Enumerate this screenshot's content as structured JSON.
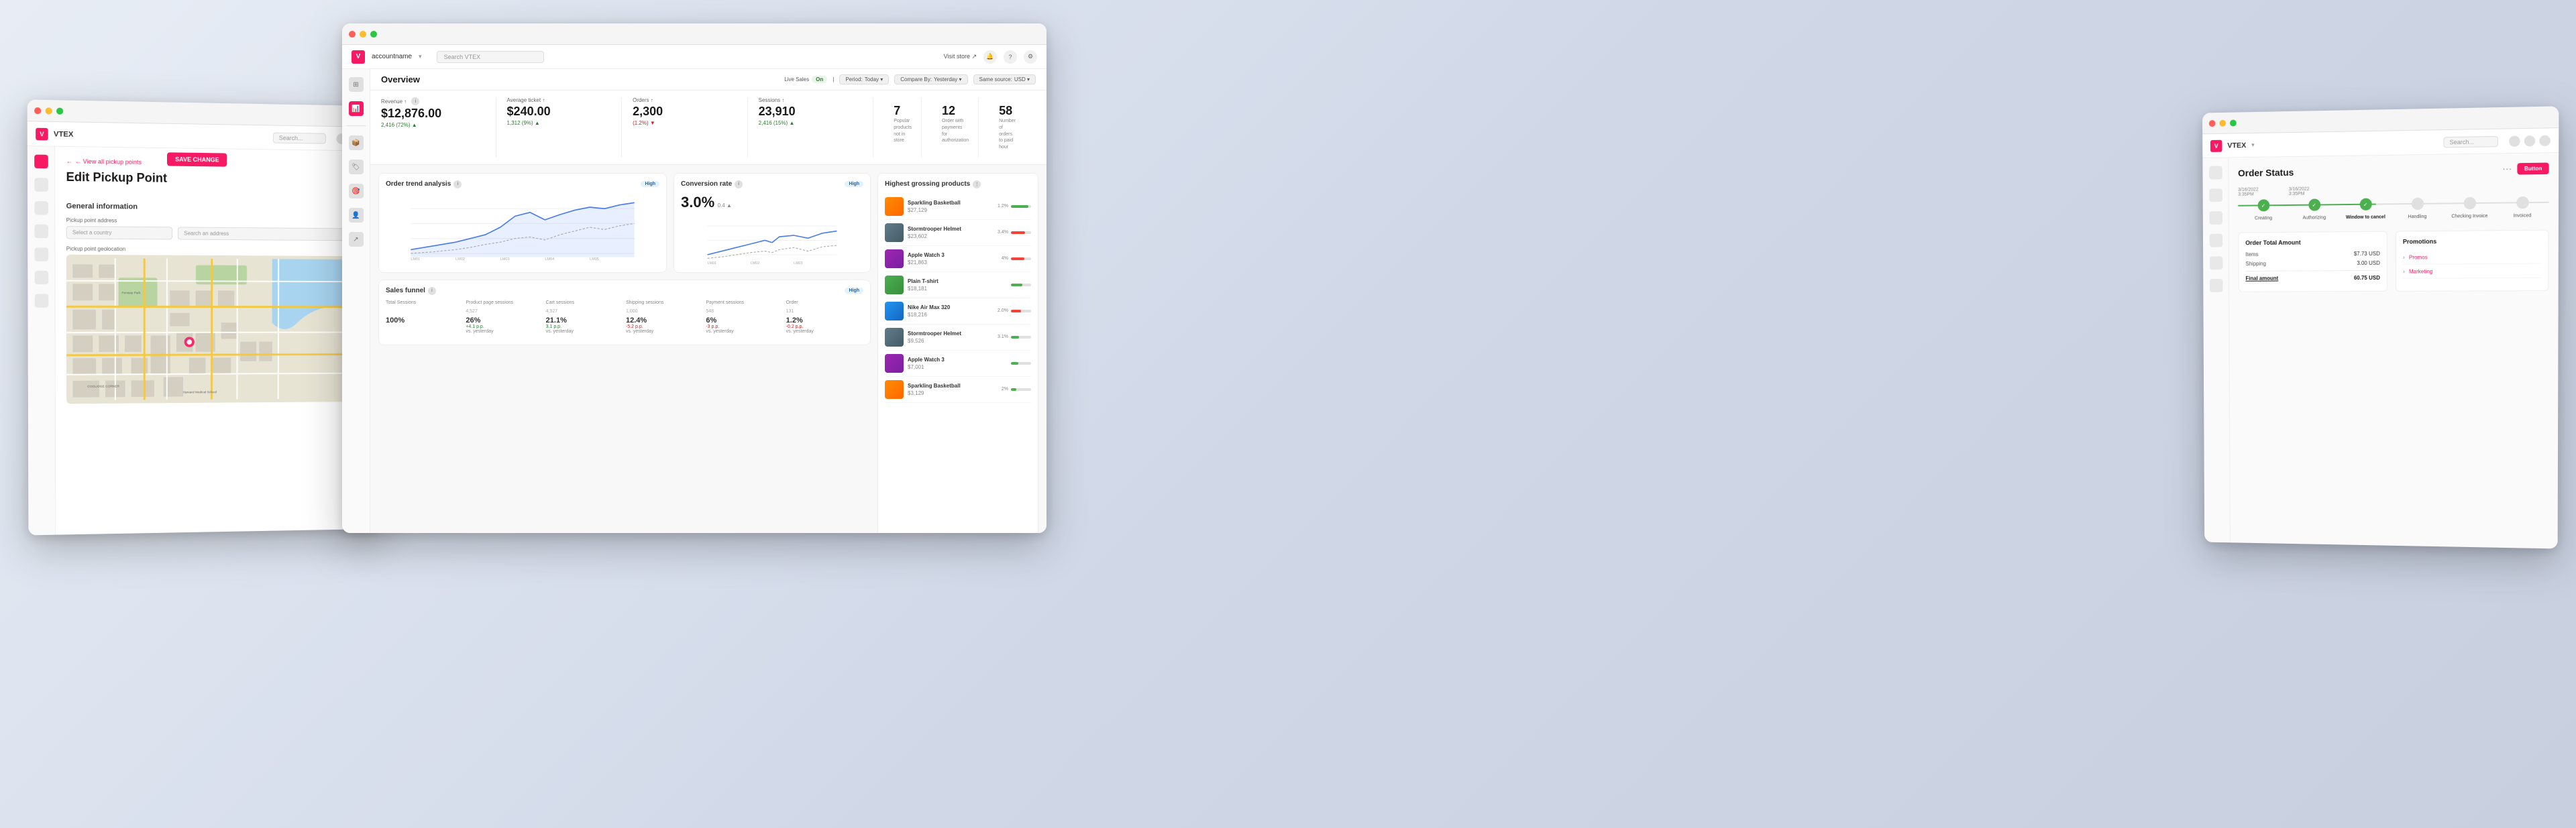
{
  "app": {
    "brand": "VTEX",
    "logo_letter": "V"
  },
  "window_left": {
    "title": "Edit Pickup Point",
    "back_link": "← View all pickup points",
    "save_btn": "SAVE CHANGE",
    "section_general": "General information",
    "section_address": "Pickup point address",
    "label_country": "Select a country",
    "label_address": "Search an address",
    "section_geolocation": "Pickup point geolocation",
    "search_placeholder": "Search..."
  },
  "window_center": {
    "account": "accountname",
    "chevron": "v",
    "search_placeholder": "Search VTEX",
    "visit_store": "Visit store ↗",
    "page_title": "Overview",
    "filter_live_sales": "Live Sales",
    "filter_on": "On",
    "filter_period": "Period:",
    "filter_today": "Today ▾",
    "filter_compare": "Compare By:",
    "filter_yesterday": "Yesterday ▾",
    "filter_source": "Same source:",
    "filter_usd": "USD ▾",
    "metrics": [
      {
        "label": "Revenue ↑",
        "value": "$12,876.00",
        "change": "2,416 (72%)  ▲",
        "type": "pos"
      },
      {
        "label": "Average ticket ↑",
        "value": "$240.00",
        "change": "1,312 (9%)  ▲",
        "type": "pos"
      },
      {
        "label": "Orders ↑",
        "value": "2,300",
        "change": "(1.2%)  ▼",
        "type": "neg"
      },
      {
        "label": "Sessions ↑",
        "value": "23,910",
        "change": "2,416 (15%)  ▲",
        "type": "pos"
      }
    ],
    "stat_boxes": [
      {
        "num": "7",
        "desc": "Popular products not in store"
      },
      {
        "num": "12",
        "desc": "Order with payments for authorization"
      },
      {
        "num": "58",
        "desc": "Number of orders to paid hour"
      }
    ],
    "charts": {
      "order_trend": {
        "title": "Order trend analysis",
        "badge": "High"
      },
      "conversion": {
        "title": "Conversion rate",
        "badge": "High",
        "value": "3.0%",
        "change": "0.4 ▲"
      },
      "sales_funnel": {
        "title": "Sales funnel",
        "badge": "High",
        "columns": [
          {
            "header": "Total Sessions",
            "value": "100%",
            "sub": "",
            "change": "",
            "type": ""
          },
          {
            "header": "Product page sessions",
            "value": "26%",
            "sub": "+4.1 p.p.",
            "change": "vs. yesterday",
            "type": "pos"
          },
          {
            "header": "Cart sessions",
            "value": "21.1%",
            "sub": "3.1 p.p.",
            "change": "vs. yesterday",
            "type": "pos"
          },
          {
            "header": "Shipping sessions",
            "value": "12.4%",
            "sub": "-5.2 p.p.",
            "change": "vs. yesterday",
            "type": "neg"
          },
          {
            "header": "Payment sessions",
            "value": "6%",
            "sub": "-3 p.p.",
            "change": "vs. yesterday",
            "type": "neg"
          },
          {
            "header": "Order",
            "value": "1.2%",
            "sub": "-0.2 p.p.",
            "change": "vs. yesterday",
            "type": "neg"
          }
        ],
        "raw_values": [
          "Total Sessions",
          "Product page sessions",
          "Cart sessions",
          "Shipping sessions",
          "Payment sessions",
          "Order"
        ],
        "raw_nums": [
          null,
          "4,527",
          "4,527",
          "1,000",
          "548",
          "131"
        ]
      }
    },
    "top_products": {
      "title": "Highest grossing products",
      "items": [
        {
          "name": "Sparkling Basketball",
          "price": "$27,129",
          "pct": "1.2%",
          "bar": 85,
          "type": "pos",
          "img": "basketball"
        },
        {
          "name": "Stormtrooper Helmet",
          "price": "$23,602",
          "pct": "3.4%",
          "bar": 70,
          "type": "neg",
          "img": "helmet"
        },
        {
          "name": "Apple Watch 3",
          "price": "$21,863",
          "pct": "4%",
          "bar": 65,
          "type": "neg",
          "img": "watch"
        },
        {
          "name": "Plain T-shirt",
          "price": "$18,181",
          "pct": "",
          "bar": 55,
          "type": "pos",
          "img": "tshirt"
        },
        {
          "name": "Nike Air Max 320",
          "price": "$18,216",
          "pct": "2.0%",
          "bar": 50,
          "type": "neg",
          "img": "air"
        },
        {
          "name": "Stormtrooper Helmet",
          "price": "$9,526",
          "pct": "3.1%",
          "bar": 40,
          "type": "pos",
          "img": "helmet"
        },
        {
          "name": "Apple Watch 3",
          "price": "$7,001",
          "pct": "",
          "bar": 35,
          "type": "pos",
          "img": "watch"
        },
        {
          "name": "Sparkling Basketball",
          "price": "$3,129",
          "pct": "2%",
          "bar": 25,
          "type": "pos",
          "img": "basketball"
        }
      ]
    }
  },
  "window_right": {
    "title": "Order Status",
    "more_icon": "⋯",
    "btn_label": "Button",
    "dates": [
      {
        "date": "3/16/2022",
        "time": "3:35PM"
      },
      {
        "date": "3/16/2022",
        "time": "3:35PM"
      },
      {
        "date": "",
        "time": ""
      },
      {
        "date": "",
        "time": ""
      },
      {
        "date": "",
        "time": ""
      },
      {
        "date": "",
        "time": ""
      }
    ],
    "timeline_steps": [
      {
        "label": "Creating",
        "state": "done"
      },
      {
        "label": "Authorizing",
        "state": "done"
      },
      {
        "label": "Window to cancel",
        "state": "done"
      },
      {
        "label": "Handling",
        "state": "inactive"
      },
      {
        "label": "Checking Invoice",
        "state": "inactive"
      },
      {
        "label": "Invoiced",
        "state": "inactive"
      }
    ],
    "amounts_title": "Order Total Amount",
    "items_label": "Items",
    "items_value": "$7.73 USD",
    "shipping_label": "Shipping",
    "shipping_value": "3.00 USD",
    "final_label": "Final amount",
    "final_value": "60.75 USD",
    "promotions_title": "Promotions",
    "promotions": [
      {
        "name": "Promos",
        "arrow": ">"
      },
      {
        "name": "Marketing",
        "arrow": ">"
      }
    ],
    "search_placeholder": "Search..."
  }
}
